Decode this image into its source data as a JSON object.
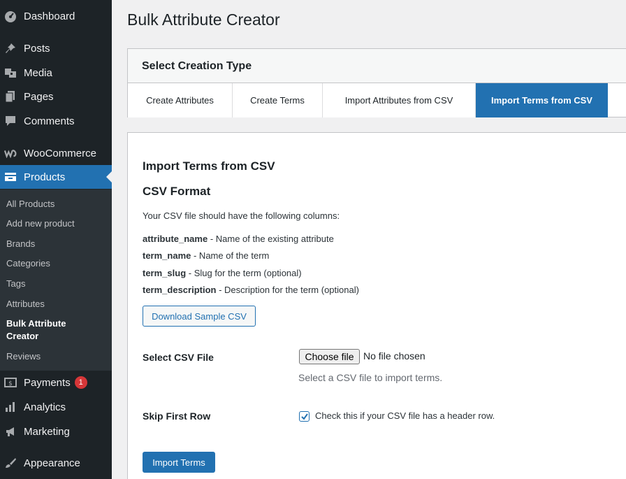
{
  "sidebar": {
    "items": [
      {
        "label": "Dashboard",
        "icon": "dashboard-icon"
      },
      {
        "label": "Posts",
        "icon": "pin-icon"
      },
      {
        "label": "Media",
        "icon": "media-icon"
      },
      {
        "label": "Pages",
        "icon": "pages-icon"
      },
      {
        "label": "Comments",
        "icon": "comment-icon"
      },
      {
        "label": "WooCommerce",
        "icon": "woocommerce-icon"
      },
      {
        "label": "Products",
        "icon": "products-icon"
      },
      {
        "label": "Payments",
        "icon": "payments-icon",
        "badge": "1"
      },
      {
        "label": "Analytics",
        "icon": "analytics-icon"
      },
      {
        "label": "Marketing",
        "icon": "megaphone-icon"
      },
      {
        "label": "Appearance",
        "icon": "paintbrush-icon"
      }
    ],
    "submenu": [
      "All Products",
      "Add new product",
      "Brands",
      "Categories",
      "Tags",
      "Attributes",
      "Bulk Attribute Creator",
      "Reviews"
    ]
  },
  "page": {
    "title": "Bulk Attribute Creator",
    "creation_type_title": "Select Creation Type",
    "tabs": [
      "Create Attributes",
      "Create Terms",
      "Import Attributes from CSV",
      "Import Terms from CSV"
    ],
    "active_tab": "Import Terms from CSV"
  },
  "import": {
    "heading": "Import Terms from CSV",
    "format_heading": "CSV Format",
    "intro": "Your CSV file should have the following columns:",
    "columns": [
      {
        "name": "attribute_name",
        "desc": " - Name of the existing attribute"
      },
      {
        "name": "term_name",
        "desc": " - Name of the term"
      },
      {
        "name": "term_slug",
        "desc": " - Slug for the term (optional)"
      },
      {
        "name": "term_description",
        "desc": " - Description for the term (optional)"
      }
    ],
    "download_label": "Download Sample CSV",
    "file_label": "Select CSV File",
    "choose_file": "Choose file",
    "no_file": "No file chosen",
    "file_help": "Select a CSV file to import terms.",
    "skip_label": "Skip First Row",
    "skip_checked": true,
    "skip_help": "Check this if your CSV file has a header row.",
    "submit_label": "Import Terms"
  },
  "colors": {
    "accent": "#2271b1",
    "sidebar": "#1d2327",
    "badge": "#d63638"
  }
}
